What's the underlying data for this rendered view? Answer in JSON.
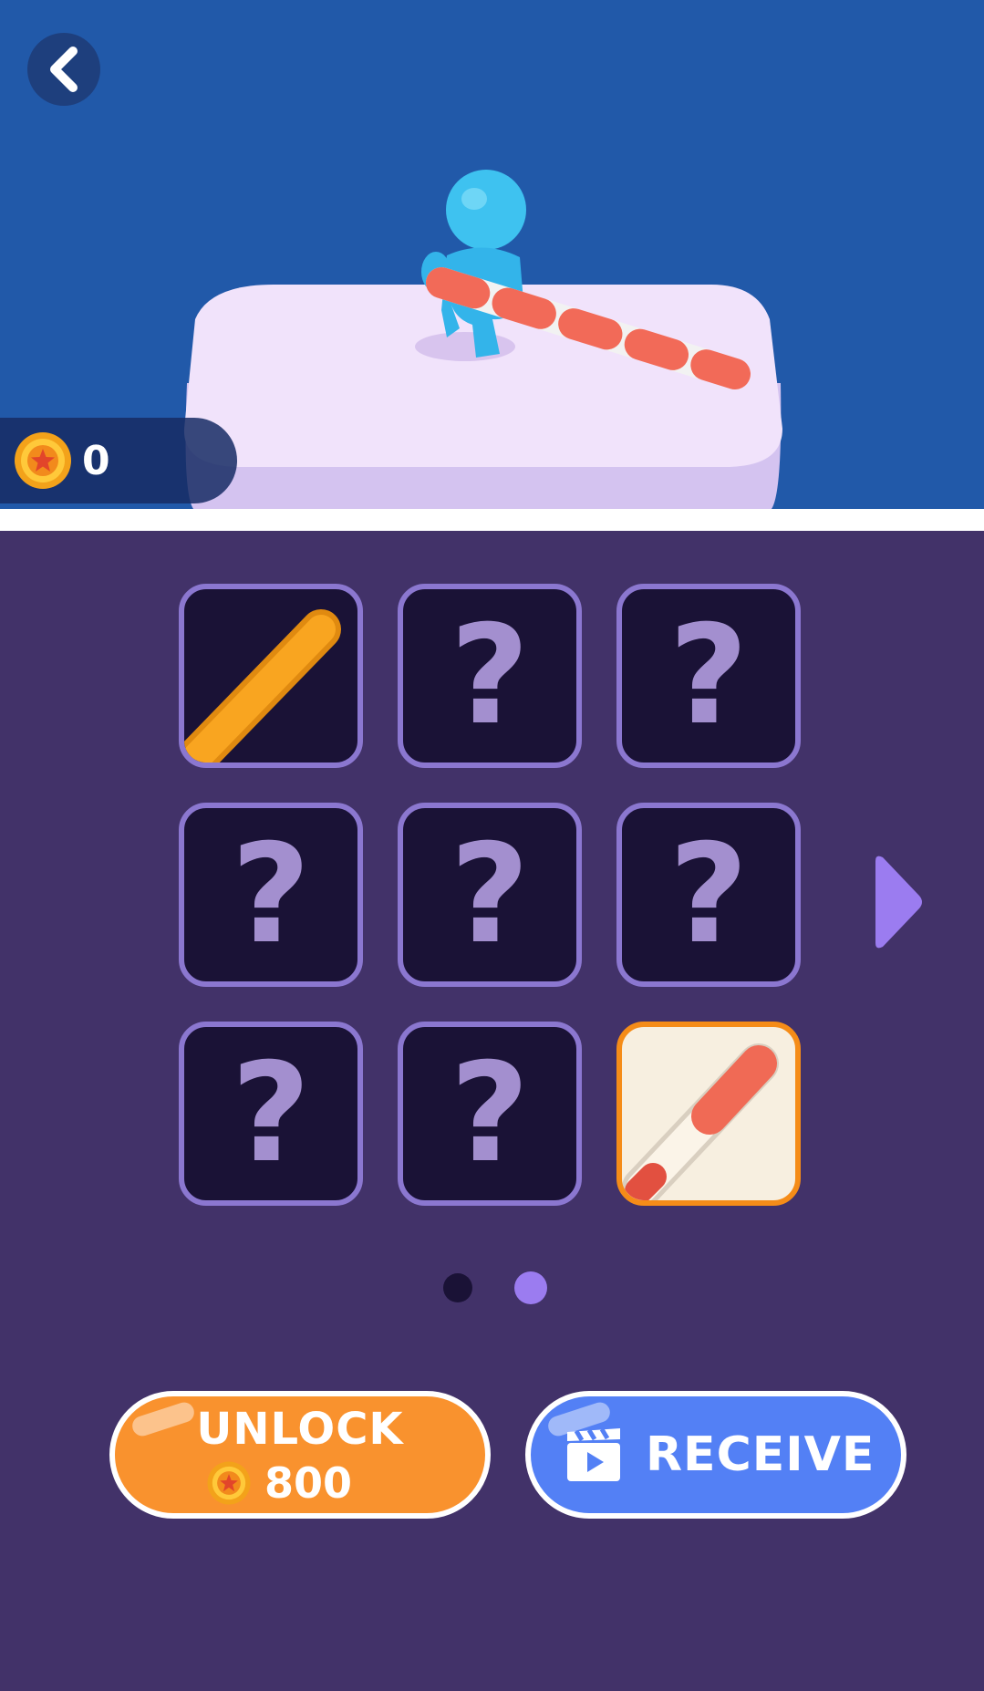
{
  "hud": {
    "coins": "0",
    "back_icon": "chevron-left-icon",
    "coin_icon": "coin-icon"
  },
  "shop": {
    "tiles": [
      {
        "state": "unlocked",
        "item": "orange-stick",
        "label": ""
      },
      {
        "state": "locked",
        "label": "?"
      },
      {
        "state": "locked",
        "label": "?"
      },
      {
        "state": "locked",
        "label": "?"
      },
      {
        "state": "locked",
        "label": "?"
      },
      {
        "state": "locked",
        "label": "?"
      },
      {
        "state": "locked",
        "label": "?"
      },
      {
        "state": "locked",
        "label": "?"
      },
      {
        "state": "selected",
        "item": "pencil-stick",
        "label": ""
      }
    ],
    "next_icon": "play-arrow-icon",
    "page_count": 2,
    "current_page": 2
  },
  "actions": {
    "unlock_label": "UNLOCK",
    "unlock_price": "800",
    "receive_label": "RECEIVE",
    "receive_icon": "video-clapper-icon"
  },
  "colors": {
    "scene_bg": "#2159a9",
    "shop_bg": "#423269",
    "tile_border": "#8b77d0",
    "tile_bg": "#1a1236",
    "selected_border": "#f58c18",
    "unlock_button": "#f9922e",
    "receive_button": "#5380f5",
    "active_dot": "#9b7cf0"
  }
}
